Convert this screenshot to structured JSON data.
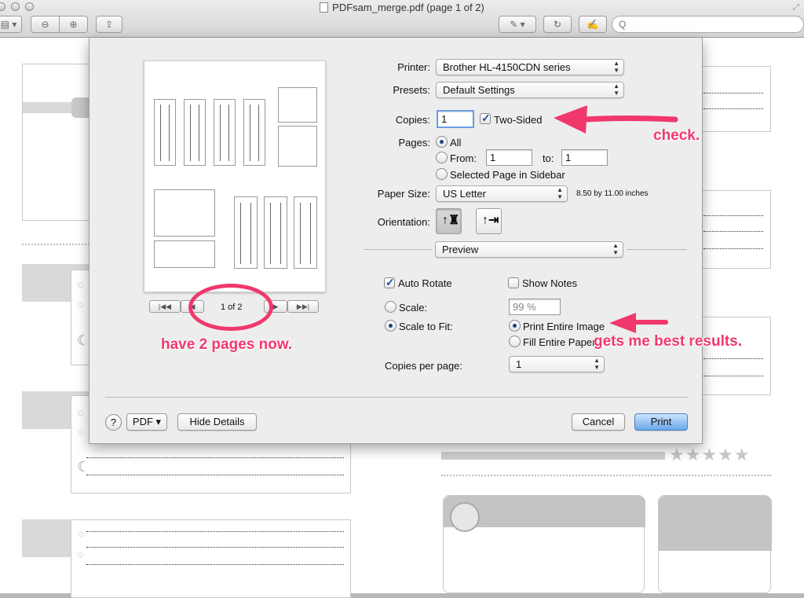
{
  "window": {
    "title": "PDFsam_merge.pdf (page 1 of 2)",
    "search_placeholder": "Q"
  },
  "dialog": {
    "printer_label": "Printer:",
    "printer_value": "Brother HL-4150CDN series",
    "presets_label": "Presets:",
    "presets_value": "Default Settings",
    "copies_label": "Copies:",
    "copies_value": "1",
    "two_sided_label": "Two-Sided",
    "two_sided_checked": true,
    "pages_label": "Pages:",
    "pages_all_label": "All",
    "pages_from_label": "From:",
    "pages_from_value": "1",
    "pages_to_label": "to:",
    "pages_to_value": "1",
    "pages_selected_label": "Selected Page in Sidebar",
    "paper_size_label": "Paper Size:",
    "paper_size_value": "US Letter",
    "paper_size_dims": "8.50 by 11.00 inches",
    "orientation_label": "Orientation:",
    "section_value": "Preview",
    "auto_rotate_label": "Auto Rotate",
    "auto_rotate_checked": true,
    "show_notes_label": "Show Notes",
    "show_notes_checked": false,
    "scale_label": "Scale:",
    "scale_value": "99 %",
    "scale_to_fit_label": "Scale to Fit:",
    "print_entire_label": "Print Entire Image",
    "fill_entire_label": "Fill Entire Paper",
    "copies_per_page_label": "Copies per page:",
    "copies_per_page_value": "1",
    "page_indicator": "1 of 2",
    "help_label": "?",
    "pdf_label": "PDF ▾",
    "hide_details_label": "Hide Details",
    "cancel_label": "Cancel",
    "print_label": "Print"
  },
  "annotations": {
    "check": "check.",
    "pages": "have 2 pages now.",
    "results": "gets me best results.",
    "color": "#f0386d"
  },
  "icons": [
    "sidebar-icon",
    "zoom-out-icon",
    "zoom-in-icon",
    "share-icon",
    "annotate-icon",
    "rotate-icon",
    "edit-icon",
    "search-icon",
    "first-page-icon",
    "prev-page-icon",
    "next-page-icon",
    "last-page-icon",
    "portrait-icon",
    "landscape-icon"
  ]
}
